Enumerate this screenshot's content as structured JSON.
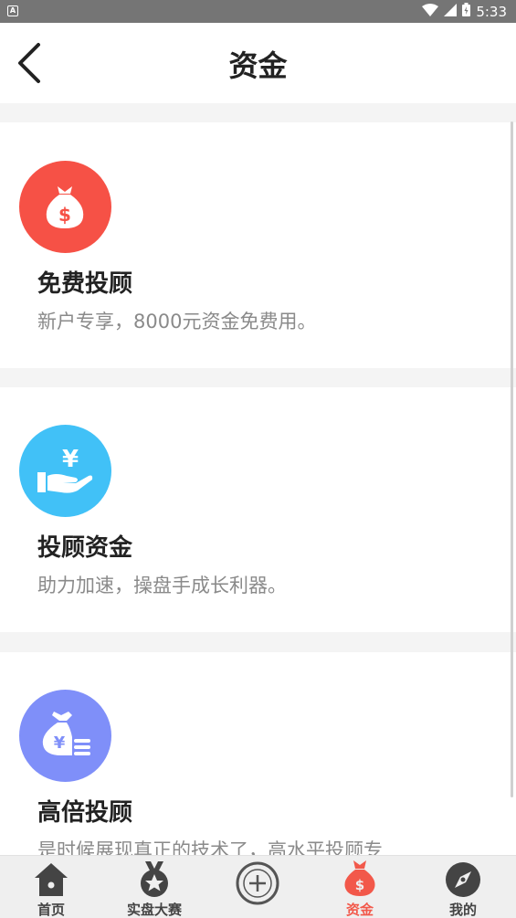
{
  "statusbar": {
    "time": "5:33",
    "left_badge": "A"
  },
  "header": {
    "title": "资金"
  },
  "cards": [
    {
      "title": "免费投顾",
      "desc": "新户专享，8000元资金免费用。",
      "color": "#f65146"
    },
    {
      "title": "投顾资金",
      "desc": "助力加速，操盘手成长利器。",
      "color": "#41c1f7"
    },
    {
      "title": "高倍投顾",
      "desc": "是时候展现真正的技术了，高水平投顾专",
      "color": "#7f8ff9"
    }
  ],
  "tabbar": {
    "items": [
      {
        "label": "首页",
        "icon": "home-icon"
      },
      {
        "label": "实盘大赛",
        "icon": "medal-icon"
      },
      {
        "label": "",
        "icon": "plus-circle-icon"
      },
      {
        "label": "资金",
        "icon": "money-bag-icon",
        "active": true
      },
      {
        "label": "我的",
        "icon": "compass-icon"
      }
    ],
    "active_color": "#f2584a"
  }
}
